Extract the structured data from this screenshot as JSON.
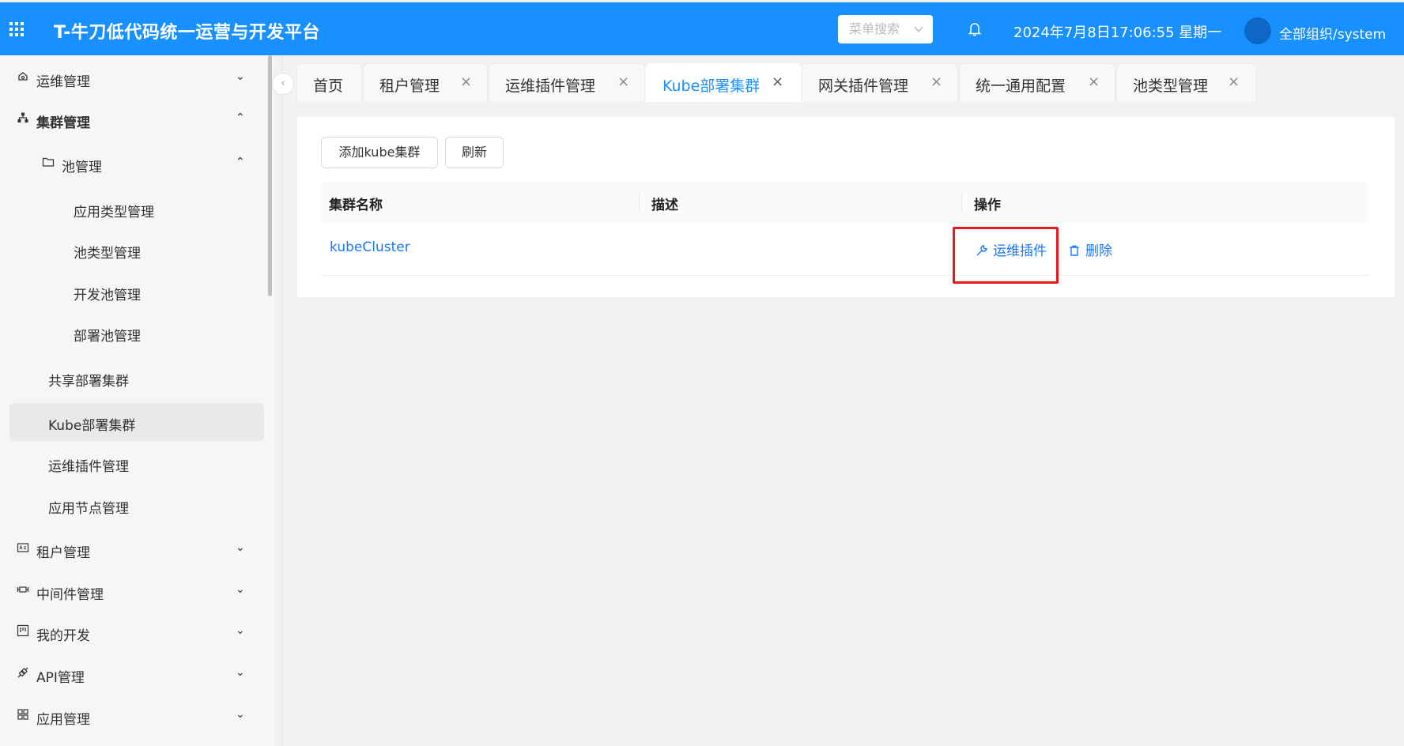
{
  "header": {
    "title": "T-牛刀低代码统一运营与开发平台",
    "menu_search_placeholder": "菜单搜索",
    "datetime": "2024年7月8日17:06:55 星期一",
    "user": "全部组织/system"
  },
  "sidebar": {
    "items": [
      {
        "label": "运维管理",
        "icon": "cloud-icon",
        "expanded": false
      },
      {
        "label": "集群管理",
        "icon": "cluster-icon",
        "expanded": true
      },
      {
        "label": "池管理",
        "icon": "folder-icon",
        "expanded": true
      },
      {
        "label": "应用类型管理"
      },
      {
        "label": "池类型管理"
      },
      {
        "label": "开发池管理"
      },
      {
        "label": "部署池管理"
      },
      {
        "label": "共享部署集群"
      },
      {
        "label": "Kube部署集群",
        "active": true
      },
      {
        "label": "运维插件管理"
      },
      {
        "label": "应用节点管理"
      },
      {
        "label": "租户管理",
        "icon": "id-card-icon",
        "expanded": false
      },
      {
        "label": "中间件管理",
        "icon": "middleware-icon",
        "expanded": false
      },
      {
        "label": "我的开发",
        "icon": "board-icon",
        "expanded": false
      },
      {
        "label": "API管理",
        "icon": "api-icon",
        "expanded": false
      },
      {
        "label": "应用管理",
        "icon": "grid-icon",
        "expanded": false
      }
    ]
  },
  "tabs": [
    {
      "label": "首页",
      "closable": false
    },
    {
      "label": "租户管理",
      "closable": true
    },
    {
      "label": "运维插件管理",
      "closable": true
    },
    {
      "label": "Kube部署集群",
      "closable": true,
      "active": true
    },
    {
      "label": "网关插件管理",
      "closable": true
    },
    {
      "label": "统一通用配置",
      "closable": true
    },
    {
      "label": "池类型管理",
      "closable": true
    }
  ],
  "toolbar": {
    "add_label": "添加kube集群",
    "refresh_label": "刷新"
  },
  "table": {
    "columns": [
      "集群名称",
      "描述",
      "操作"
    ],
    "rows": [
      {
        "name": "kubeCluster",
        "description": "",
        "actions": [
          "运维插件",
          "删除"
        ]
      }
    ]
  },
  "colors": {
    "header": "#1890ff",
    "link": "#1677ff",
    "highlight": "#e81919"
  }
}
